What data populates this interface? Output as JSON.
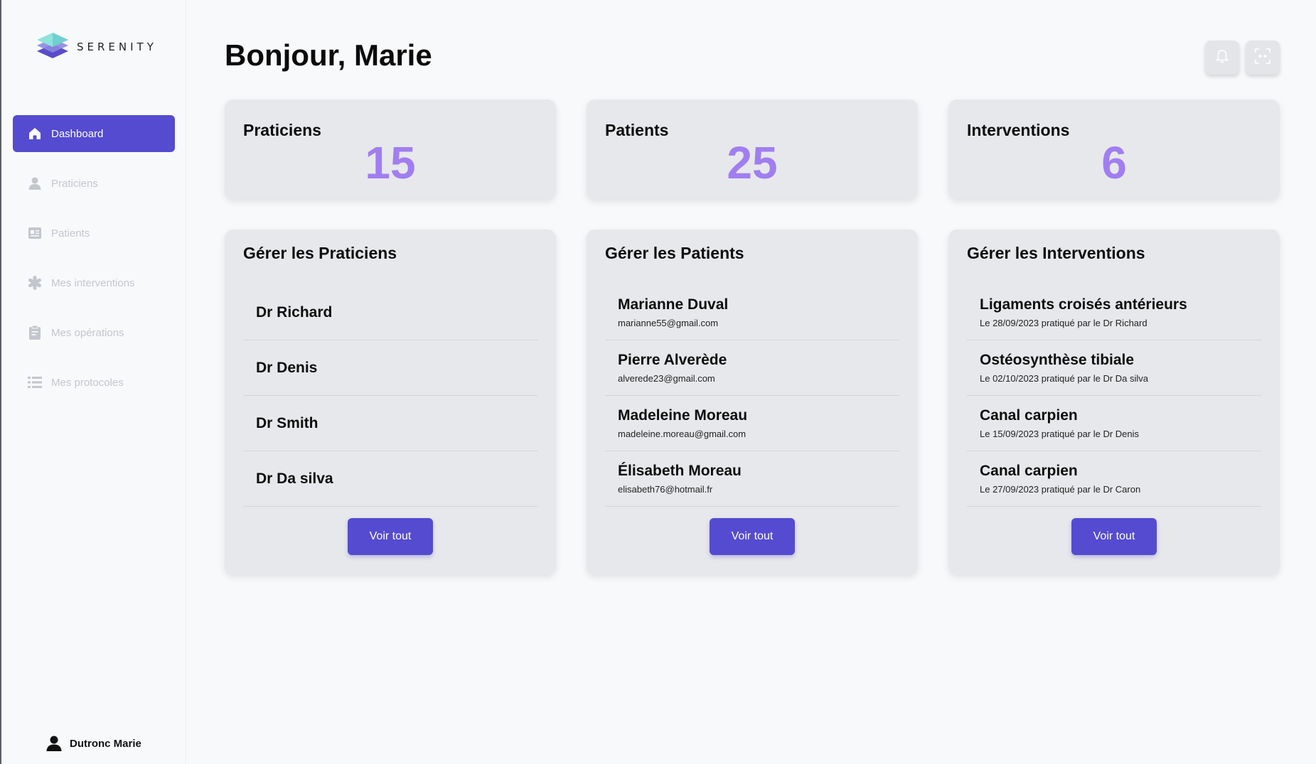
{
  "brand": {
    "name": "SERENITY"
  },
  "sidebar": {
    "items": [
      {
        "label": "Dashboard",
        "icon": "home-icon"
      },
      {
        "label": "Praticiens",
        "icon": "person-icon"
      },
      {
        "label": "Patients",
        "icon": "id-card-icon"
      },
      {
        "label": "Mes interventions",
        "icon": "asterisk-icon"
      },
      {
        "label": "Mes opérations",
        "icon": "clipboard-icon"
      },
      {
        "label": "Mes protocoles",
        "icon": "list-icon"
      }
    ],
    "user": "Dutronc Marie"
  },
  "header": {
    "greeting": "Bonjour, Marie",
    "buttons": [
      "bell-icon",
      "fullscreen-icon"
    ]
  },
  "stats": [
    {
      "title": "Praticiens",
      "value": "15"
    },
    {
      "title": "Patients",
      "value": "25"
    },
    {
      "title": "Interventions",
      "value": "6"
    }
  ],
  "panels": [
    {
      "title": "Gérer les Praticiens",
      "rows": [
        {
          "title": "Dr Richard"
        },
        {
          "title": "Dr Denis"
        },
        {
          "title": "Dr Smith"
        },
        {
          "title": "Dr Da silva"
        }
      ],
      "button": "Voir tout"
    },
    {
      "title": "Gérer les Patients",
      "rows": [
        {
          "title": "Marianne Duval",
          "sub": "marianne55@gmail.com"
        },
        {
          "title": "Pierre Alverède",
          "sub": "alverede23@gmail.com"
        },
        {
          "title": "Madeleine Moreau",
          "sub": "madeleine.moreau@gmail.com"
        },
        {
          "title": "Élisabeth Moreau",
          "sub": "elisabeth76@hotmail.fr"
        }
      ],
      "button": "Voir tout"
    },
    {
      "title": "Gérer les Interventions",
      "rows": [
        {
          "title": "Ligaments croisés antérieurs",
          "sub": "Le 28/09/2023 pratiqué par le Dr Richard"
        },
        {
          "title": "Ostéosynthèse tibiale",
          "sub": "Le 02/10/2023 pratiqué par le Dr Da silva"
        },
        {
          "title": "Canal carpien",
          "sub": "Le 15/09/2023 pratiqué par le Dr Denis"
        },
        {
          "title": "Canal carpien",
          "sub": "Le 27/09/2023 pratiqué par le Dr Caron"
        }
      ],
      "button": "Voir tout"
    }
  ],
  "colors": {
    "accent": "#544bd1",
    "stat_number": "#a07ef0",
    "card": "#e7e8eb"
  }
}
